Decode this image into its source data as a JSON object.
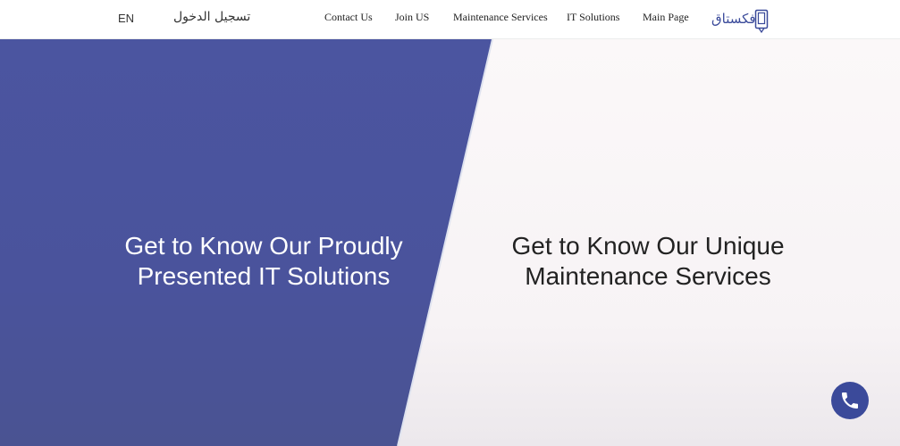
{
  "header": {
    "lang": "EN",
    "login": "تسجيل الدخول",
    "nav": [
      "Contact Us",
      "Join US",
      "Maintenance Services",
      "IT Solutions",
      "Main Page"
    ],
    "logo_text": "فكستاق"
  },
  "hero": {
    "left_title": "Get to Know Our Proudly Presented IT Solutions",
    "right_title": "Get to Know Our Unique Maintenance Services"
  },
  "colors": {
    "brand": "#3b4a9a",
    "left_panel": "#4b55a0",
    "right_panel": "#fbf8f9"
  },
  "icons": {
    "logo": "phone-tablet-icon",
    "call": "phone-icon"
  }
}
